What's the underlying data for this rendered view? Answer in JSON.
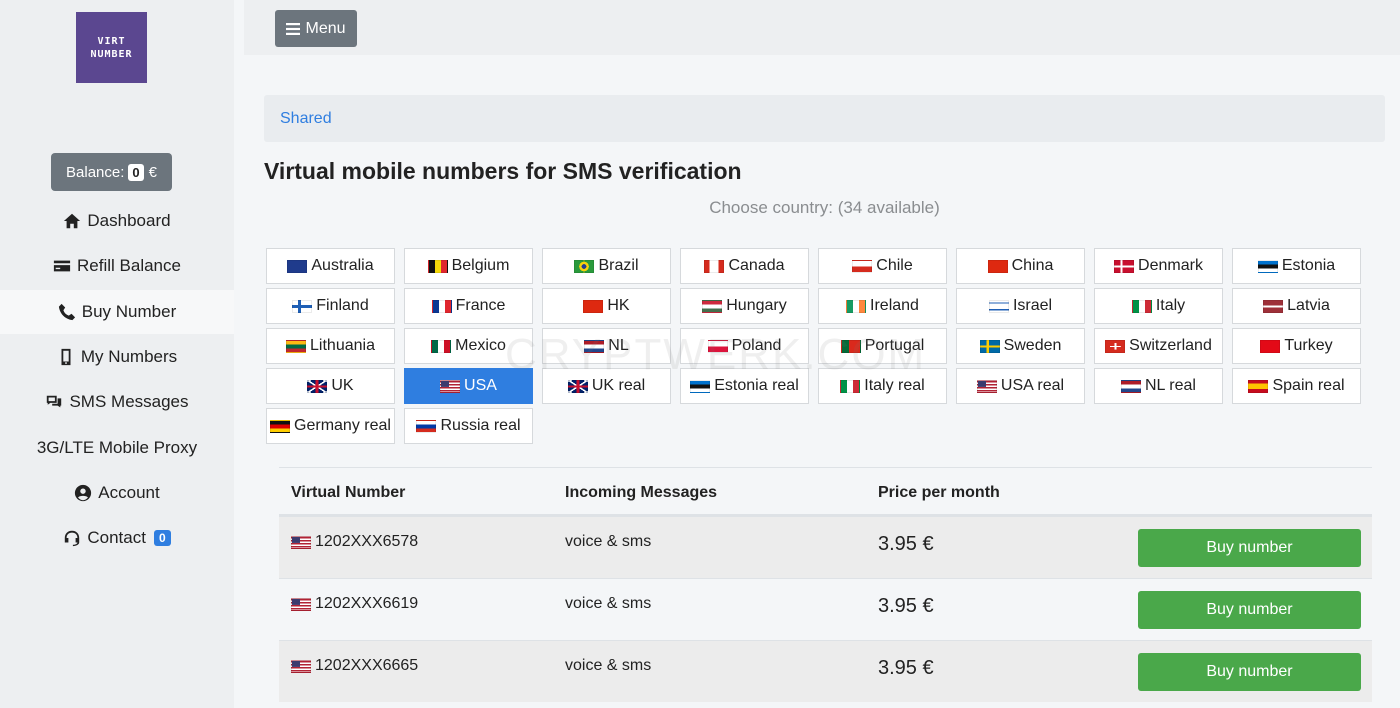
{
  "logo": {
    "line1": "VIRT",
    "line2": "NUMBER"
  },
  "balance": {
    "label": "Balance:",
    "amount": "0",
    "currency": "€"
  },
  "nav": [
    {
      "label": "Dashboard",
      "icon": "home-icon"
    },
    {
      "label": "Refill Balance",
      "icon": "credit-card-icon"
    },
    {
      "label": "Buy Number",
      "icon": "phone-icon"
    },
    {
      "label": "My Numbers",
      "icon": "mobile-icon"
    },
    {
      "label": "SMS Messages",
      "icon": "chat-icon"
    },
    {
      "label": "3G/LTE Mobile Proxy",
      "icon": ""
    },
    {
      "label": "Account",
      "icon": "user-circle-icon"
    },
    {
      "label": "Contact",
      "icon": "headset-icon",
      "badge": "0"
    }
  ],
  "topbar": {
    "menu_label": "Menu"
  },
  "breadcrumb": {
    "item": "Shared"
  },
  "title": "Virtual mobile numbers for SMS verification",
  "choose_country": "Choose country: (34 available)",
  "countries": [
    "Australia",
    "Belgium",
    "Brazil",
    "Canada",
    "Chile",
    "China",
    "Denmark",
    "Estonia",
    "Finland",
    "France",
    "HK",
    "Hungary",
    "Ireland",
    "Israel",
    "Italy",
    "Latvia",
    "Lithuania",
    "Mexico",
    "NL",
    "Poland",
    "Portugal",
    "Sweden",
    "Switzerland",
    "Turkey",
    "UK",
    "USA",
    "UK real",
    "Estonia real",
    "Italy real",
    "USA real",
    "NL real",
    "Spain real",
    "Germany real",
    "Russia real"
  ],
  "selected_country": "USA",
  "table": {
    "headers": {
      "number": "Virtual Number",
      "messages": "Incoming Messages",
      "price": "Price per month"
    },
    "rows": [
      {
        "number": "1202XXX6578",
        "messages": "voice & sms",
        "price": "3.95 €",
        "action": "Buy number"
      },
      {
        "number": "1202XXX6619",
        "messages": "voice & sms",
        "price": "3.95 €",
        "action": "Buy number"
      },
      {
        "number": "1202XXX6665",
        "messages": "voice & sms",
        "price": "3.95 €",
        "action": "Buy number"
      }
    ]
  },
  "watermark": "CRYPTWERK.COM",
  "colors": {
    "primary": "#2f7ee0",
    "success": "#4aa84a",
    "secondary": "#6c757d",
    "logo_bg": "#5b4790"
  }
}
